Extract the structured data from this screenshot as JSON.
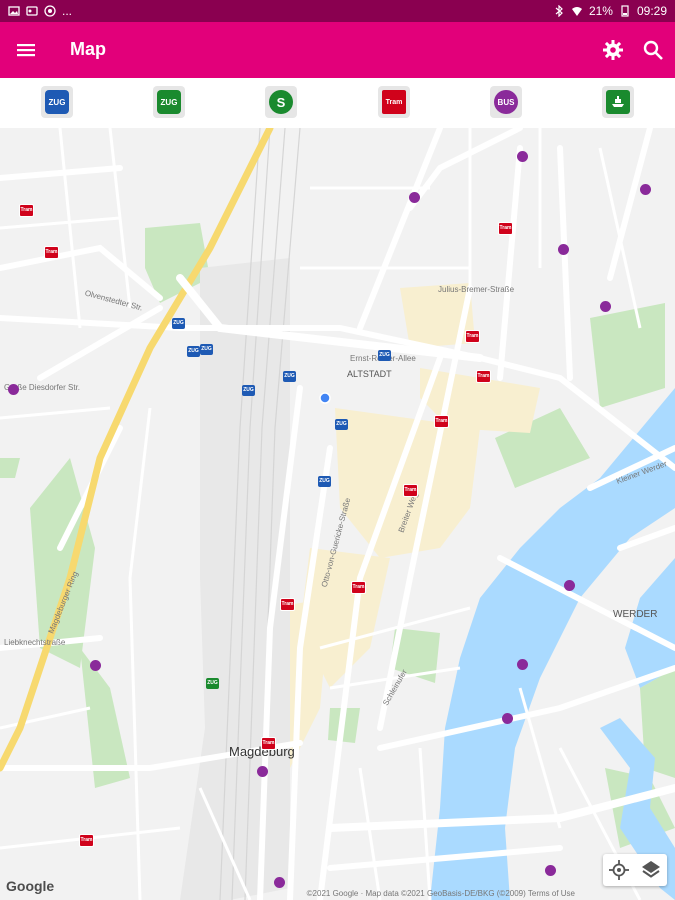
{
  "statusbar": {
    "notif_more": "...",
    "battery": "21%",
    "time": "09:29"
  },
  "appbar": {
    "title": "Map"
  },
  "filters": [
    {
      "name": "zug-regional",
      "label": "ZUG",
      "color": "#1e5ab4"
    },
    {
      "name": "zug-local",
      "label": "ZUG",
      "color": "#1a8a2e"
    },
    {
      "name": "s-bahn",
      "label": "S",
      "color": "#1a8a2e"
    },
    {
      "name": "tram",
      "label": "Tram",
      "color": "#d0021b"
    },
    {
      "name": "bus",
      "label": "BUS",
      "color": "#8a2a9a"
    },
    {
      "name": "ferry",
      "label": "",
      "color": "#1a8a2e"
    }
  ],
  "map": {
    "labels": {
      "altstadt": "ALTSTADT",
      "magdeburg": "Magdeburg",
      "werder": "WERDER",
      "olvenstedter": "Olvenstedter Str.",
      "diesdorfer": "Große Diesdorfer Str.",
      "ernst_reuter": "Ernst-Reuter-Allee",
      "julius_bremer": "Julius-Bremer-Straße",
      "breiter_weg": "Breiter Weg",
      "otto_von_guericke": "Otto-von-Guericke-Straße",
      "magdeburger_ring": "Magdeburger Ring",
      "liebknechtstrasse": "Liebknechtstraße",
      "schleinufer": "Schleinufer",
      "kleiner_werder": "Kleiner Werder"
    },
    "google": "Google",
    "attribution": "©2021 Google · Map data ©2021 GeoBasis-DE/BKG (©2009) Terms of Use"
  },
  "markers": {
    "zug": "ZUG",
    "tram": "Tram",
    "bus": "BUS"
  }
}
